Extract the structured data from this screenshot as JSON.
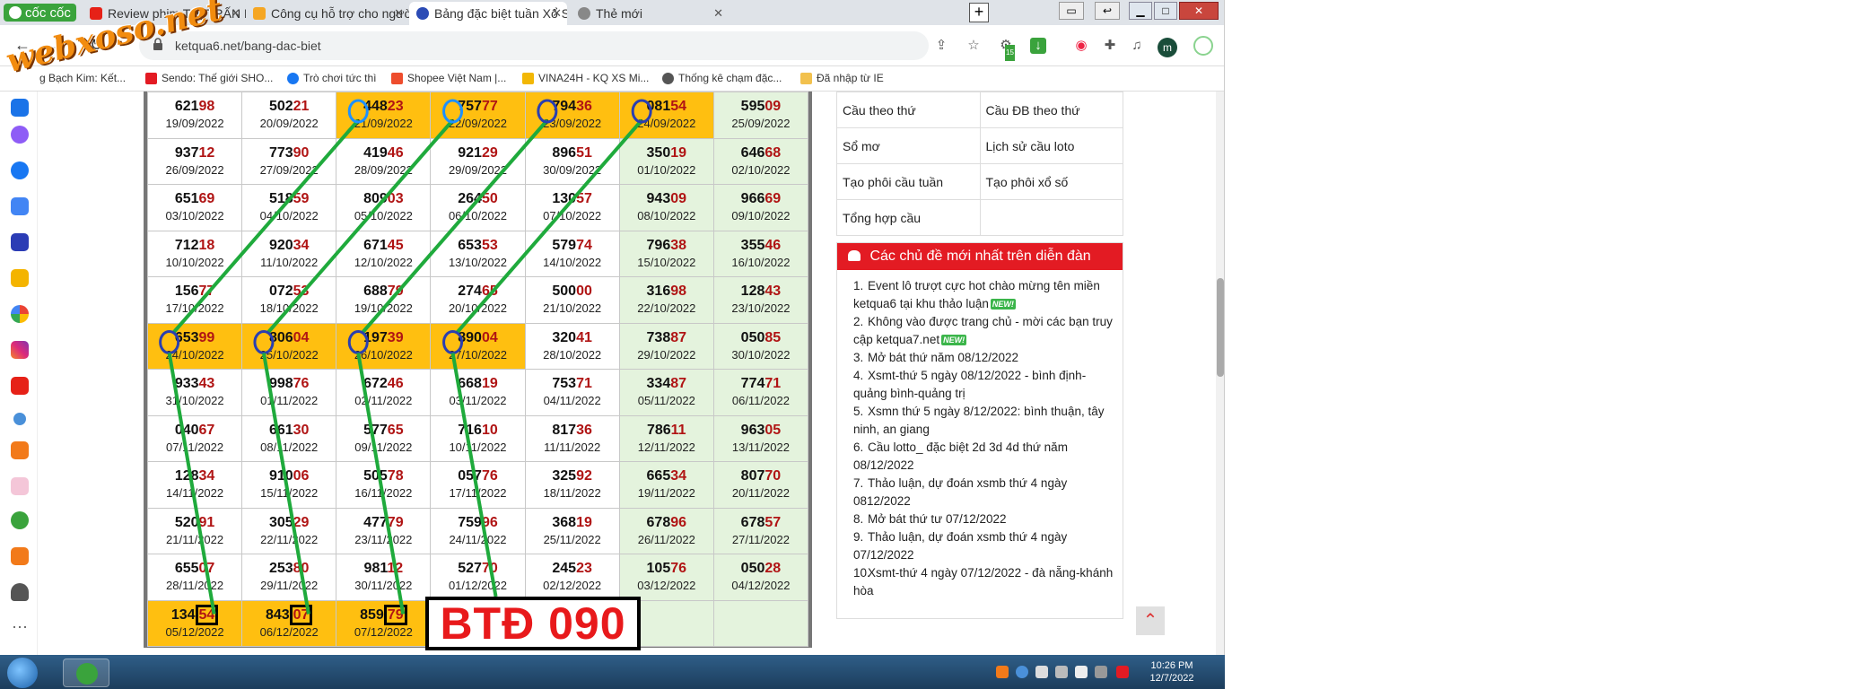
{
  "browser": {
    "brand": "cốc cốc",
    "tabs": [
      {
        "label": "Review phim THỊ TRẤN RỪNG",
        "color": "#e62117"
      },
      {
        "label": "Công cụ hỗ trợ cho người ch",
        "color": "#f5a623"
      },
      {
        "label": "Bảng đặc biệt tuần Xổ Số Trư",
        "color": "#2b4bb5"
      },
      {
        "label": "Thẻ mới",
        "color": "#666666"
      }
    ],
    "new_tab": "+",
    "url": "ketqua6.net/bang-dac-biet",
    "avatar_letter": "m",
    "badge": "15"
  },
  "watermark": "webxoso.net",
  "bookmarks": [
    {
      "label": "g Bạch Kim: Kết...",
      "color": "#cc3333"
    },
    {
      "label": "Sendo: Thế giới SHO...",
      "color": "#e31b23"
    },
    {
      "label": "Trò chơi tức thì",
      "color": "#1877f2"
    },
    {
      "label": "Shopee Việt Nam |...",
      "color": "#ee4d2d"
    },
    {
      "label": "VINA24H - KQ XS Mi...",
      "color": "#f2b705"
    },
    {
      "label": "Thống kê chạm đặc...",
      "color": "#555555"
    },
    {
      "label": "Đã nhập từ IE",
      "color": "#f2c14e"
    }
  ],
  "results": {
    "rows": [
      [
        {
          "h": "621",
          "t": "98",
          "d": "19/09/2022"
        },
        {
          "h": "502",
          "t": "21",
          "d": "20/09/2022"
        },
        {
          "h": "448",
          "t": "23",
          "d": "21/09/2022",
          "hl": true
        },
        {
          "h": "757",
          "t": "77",
          "d": "22/09/2022",
          "hl": true
        },
        {
          "h": "794",
          "t": "36",
          "d": "23/09/2022",
          "hl": true
        },
        {
          "h": "081",
          "t": "54",
          "d": "24/09/2022",
          "hl": true
        },
        {
          "h": "595",
          "t": "09",
          "d": "25/09/2022"
        }
      ],
      [
        {
          "h": "937",
          "t": "12",
          "d": "26/09/2022"
        },
        {
          "h": "773",
          "t": "90",
          "d": "27/09/2022"
        },
        {
          "h": "419",
          "t": "46",
          "d": "28/09/2022"
        },
        {
          "h": "921",
          "t": "29",
          "d": "29/09/2022"
        },
        {
          "h": "896",
          "t": "51",
          "d": "30/09/2022"
        },
        {
          "h": "350",
          "t": "19",
          "d": "01/10/2022"
        },
        {
          "h": "646",
          "t": "68",
          "d": "02/10/2022"
        }
      ],
      [
        {
          "h": "651",
          "t": "69",
          "d": "03/10/2022"
        },
        {
          "h": "518",
          "t": "59",
          "d": "04/10/2022"
        },
        {
          "h": "809",
          "t": "03",
          "d": "05/10/2022"
        },
        {
          "h": "264",
          "t": "50",
          "d": "06/10/2022"
        },
        {
          "h": "130",
          "t": "57",
          "d": "07/10/2022"
        },
        {
          "h": "943",
          "t": "09",
          "d": "08/10/2022"
        },
        {
          "h": "966",
          "t": "69",
          "d": "09/10/2022"
        }
      ],
      [
        {
          "h": "712",
          "t": "18",
          "d": "10/10/2022"
        },
        {
          "h": "920",
          "t": "34",
          "d": "11/10/2022"
        },
        {
          "h": "671",
          "t": "45",
          "d": "12/10/2022"
        },
        {
          "h": "653",
          "t": "53",
          "d": "13/10/2022"
        },
        {
          "h": "579",
          "t": "74",
          "d": "14/10/2022"
        },
        {
          "h": "796",
          "t": "38",
          "d": "15/10/2022"
        },
        {
          "h": "355",
          "t": "46",
          "d": "16/10/2022"
        }
      ],
      [
        {
          "h": "156",
          "t": "77",
          "d": "17/10/2022"
        },
        {
          "h": "072",
          "t": "53",
          "d": "18/10/2022"
        },
        {
          "h": "688",
          "t": "79",
          "d": "19/10/2022"
        },
        {
          "h": "274",
          "t": "65",
          "d": "20/10/2022"
        },
        {
          "h": "500",
          "t": "00",
          "d": "21/10/2022"
        },
        {
          "h": "316",
          "t": "98",
          "d": "22/10/2022"
        },
        {
          "h": "128",
          "t": "43",
          "d": "23/10/2022"
        }
      ],
      [
        {
          "h": "653",
          "t": "99",
          "d": "24/10/2022",
          "hl": true
        },
        {
          "h": "806",
          "t": "04",
          "d": "25/10/2022",
          "hl": true
        },
        {
          "h": "197",
          "t": "39",
          "d": "26/10/2022",
          "hl": true
        },
        {
          "h": "890",
          "t": "04",
          "d": "27/10/2022",
          "hl": true
        },
        {
          "h": "320",
          "t": "41",
          "d": "28/10/2022"
        },
        {
          "h": "738",
          "t": "87",
          "d": "29/10/2022"
        },
        {
          "h": "050",
          "t": "85",
          "d": "30/10/2022"
        }
      ],
      [
        {
          "h": "933",
          "t": "43",
          "d": "31/10/2022"
        },
        {
          "h": "998",
          "t": "76",
          "d": "01/11/2022"
        },
        {
          "h": "672",
          "t": "46",
          "d": "02/11/2022"
        },
        {
          "h": "668",
          "t": "19",
          "d": "03/11/2022"
        },
        {
          "h": "753",
          "t": "71",
          "d": "04/11/2022"
        },
        {
          "h": "334",
          "t": "87",
          "d": "05/11/2022"
        },
        {
          "h": "774",
          "t": "71",
          "d": "06/11/2022"
        }
      ],
      [
        {
          "h": "040",
          "t": "67",
          "d": "07/11/2022"
        },
        {
          "h": "661",
          "t": "30",
          "d": "08/11/2022"
        },
        {
          "h": "577",
          "t": "65",
          "d": "09/11/2022"
        },
        {
          "h": "716",
          "t": "10",
          "d": "10/11/2022"
        },
        {
          "h": "817",
          "t": "36",
          "d": "11/11/2022"
        },
        {
          "h": "786",
          "t": "11",
          "d": "12/11/2022"
        },
        {
          "h": "963",
          "t": "05",
          "d": "13/11/2022"
        }
      ],
      [
        {
          "h": "128",
          "t": "34",
          "d": "14/11/2022"
        },
        {
          "h": "910",
          "t": "06",
          "d": "15/11/2022"
        },
        {
          "h": "505",
          "t": "78",
          "d": "16/11/2022"
        },
        {
          "h": "057",
          "t": "76",
          "d": "17/11/2022"
        },
        {
          "h": "325",
          "t": "92",
          "d": "18/11/2022"
        },
        {
          "h": "665",
          "t": "34",
          "d": "19/11/2022"
        },
        {
          "h": "807",
          "t": "70",
          "d": "20/11/2022"
        }
      ],
      [
        {
          "h": "520",
          "t": "91",
          "d": "21/11/2022"
        },
        {
          "h": "305",
          "t": "29",
          "d": "22/11/2022"
        },
        {
          "h": "477",
          "t": "79",
          "d": "23/11/2022"
        },
        {
          "h": "759",
          "t": "96",
          "d": "24/11/2022"
        },
        {
          "h": "368",
          "t": "19",
          "d": "25/11/2022"
        },
        {
          "h": "678",
          "t": "96",
          "d": "26/11/2022"
        },
        {
          "h": "678",
          "t": "57",
          "d": "27/11/2022"
        }
      ],
      [
        {
          "h": "655",
          "t": "07",
          "d": "28/11/2022"
        },
        {
          "h": "253",
          "t": "80",
          "d": "29/11/2022"
        },
        {
          "h": "981",
          "t": "12",
          "d": "30/11/2022"
        },
        {
          "h": "527",
          "t": "70",
          "d": "01/12/2022"
        },
        {
          "h": "245",
          "t": "23",
          "d": "02/12/2022"
        },
        {
          "h": "105",
          "t": "76",
          "d": "03/12/2022"
        },
        {
          "h": "050",
          "t": "28",
          "d": "04/12/2022"
        }
      ],
      [
        {
          "h": "134",
          "t": "54",
          "d": "05/12/2022",
          "hl": true,
          "box": true
        },
        {
          "h": "843",
          "t": "07",
          "d": "06/12/2022",
          "hl": true,
          "box": true
        },
        {
          "h": "859",
          "t": "79",
          "d": "07/12/2022",
          "hl": true,
          "box": true
        },
        {
          "h": "",
          "t": "",
          "d": ""
        },
        {
          "h": "",
          "t": "",
          "d": ""
        },
        {
          "h": "",
          "t": "",
          "d": ""
        },
        {
          "h": "",
          "t": "",
          "d": ""
        }
      ]
    ],
    "annotation": "BTĐ 090"
  },
  "side_links": [
    [
      "Cầu theo thứ",
      "Cầu ĐB theo thứ"
    ],
    [
      "Sổ mơ",
      "Lịch sử cầu loto"
    ],
    [
      "Tạo phôi cầu tuần",
      "Tạo phôi xổ số"
    ],
    [
      "Tổng hợp cầu",
      ""
    ]
  ],
  "forum": {
    "title": "Các chủ đề mới nhất trên diễn đàn",
    "new_tag": "NEW!",
    "items": [
      {
        "n": "1.",
        "text": "Event lô trượt cực hot chào mừng tên miền ketqua6 tại khu thảo luận",
        "new": true
      },
      {
        "n": "2.",
        "text": "Không vào được trang chủ - mời các bạn truy cập ketqua7.net",
        "new": true
      },
      {
        "n": "3.",
        "text": "Mở bát thứ năm 08/12/2022",
        "new": false
      },
      {
        "n": "4.",
        "text": "Xsmt-thứ 5 ngày 08/12/2022 - bình định-quảng bình-quảng trị",
        "new": false
      },
      {
        "n": "5.",
        "text": "Xsmn thứ 5 ngày 8/12/2022: bình thuận, tây ninh, an giang",
        "new": false
      },
      {
        "n": "6.",
        "text": "Cầu lotto_ đặc biệt 2d 3d 4d thứ năm 08/12/2022",
        "new": false
      },
      {
        "n": "7.",
        "text": "Thảo luận, dự đoán xsmb thứ 4 ngày 0812/2022",
        "new": false
      },
      {
        "n": "8.",
        "text": "Mở bát thứ tư 07/12/2022",
        "new": false
      },
      {
        "n": "9.",
        "text": "Thảo luận, dự đoán xsmb thứ 4 ngày 07/12/2022",
        "new": false
      },
      {
        "n": "10.",
        "text": "Xsmt-thứ 4 ngày 07/12/2022 - đà nẵng-khánh hòa",
        "new": false
      }
    ]
  },
  "taskbar": {
    "time": "10:26 PM",
    "date": "12/7/2022"
  },
  "colors": {
    "highlight": "#ffbf10",
    "weekend": "#e4f3dd",
    "tail": "#b01414",
    "arrow": "#1faa3c",
    "circle": "#2a3fb0",
    "annotation": "#e8191b"
  }
}
